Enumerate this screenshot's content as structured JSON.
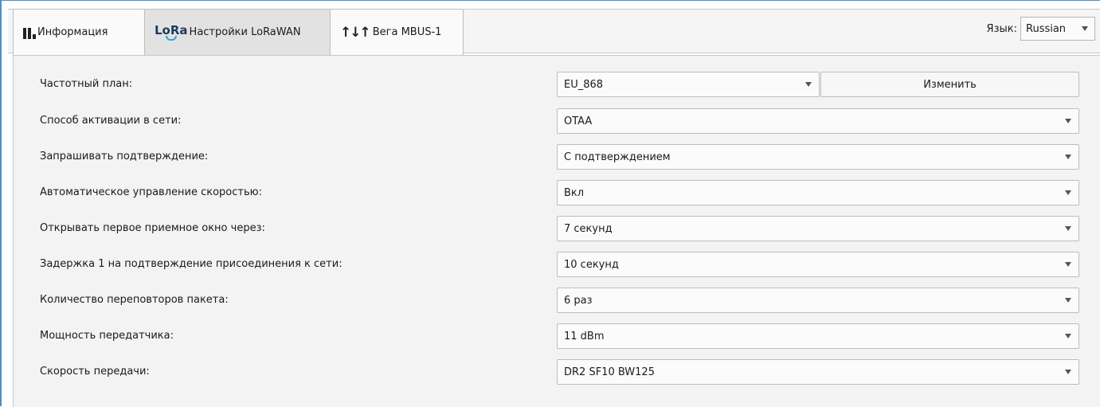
{
  "tabs": [
    {
      "label": "Информация",
      "icon": "signal-bars-icon"
    },
    {
      "label": "Настройки LoRaWAN",
      "icon": "lora-logo-icon",
      "logo_text": "LoRa"
    },
    {
      "label": "Вега MBUS-1",
      "icon": "arrows-updown-icon",
      "glyph": "↑↓↑"
    }
  ],
  "active_tab": 1,
  "language": {
    "label": "Язык:",
    "value": "Russian"
  },
  "settings": [
    {
      "label": "Частотный план:",
      "value": "EU_868",
      "button": "Изменить"
    },
    {
      "label": "Способ активации в сети:",
      "value": "OTAA"
    },
    {
      "label": "Запрашивать подтверждение:",
      "value": "С подтверждением"
    },
    {
      "label": "Автоматическое управление скоростью:",
      "value": "Вкл"
    },
    {
      "label": "Открывать первое приемное окно через:",
      "value": "7 секунд"
    },
    {
      "label": "Задержка 1 на подтверждение присоединения к сети:",
      "value": "10 секунд"
    },
    {
      "label": "Количество переповторов пакета:",
      "value": "6 раз"
    },
    {
      "label": "Мощность передатчика:",
      "value": "11 dBm"
    },
    {
      "label": "Скорость передачи:",
      "value": "DR2 SF10 BW125"
    }
  ],
  "colors": {
    "accent_border": "#4a90c8",
    "panel_bg": "#f3f3f3"
  }
}
